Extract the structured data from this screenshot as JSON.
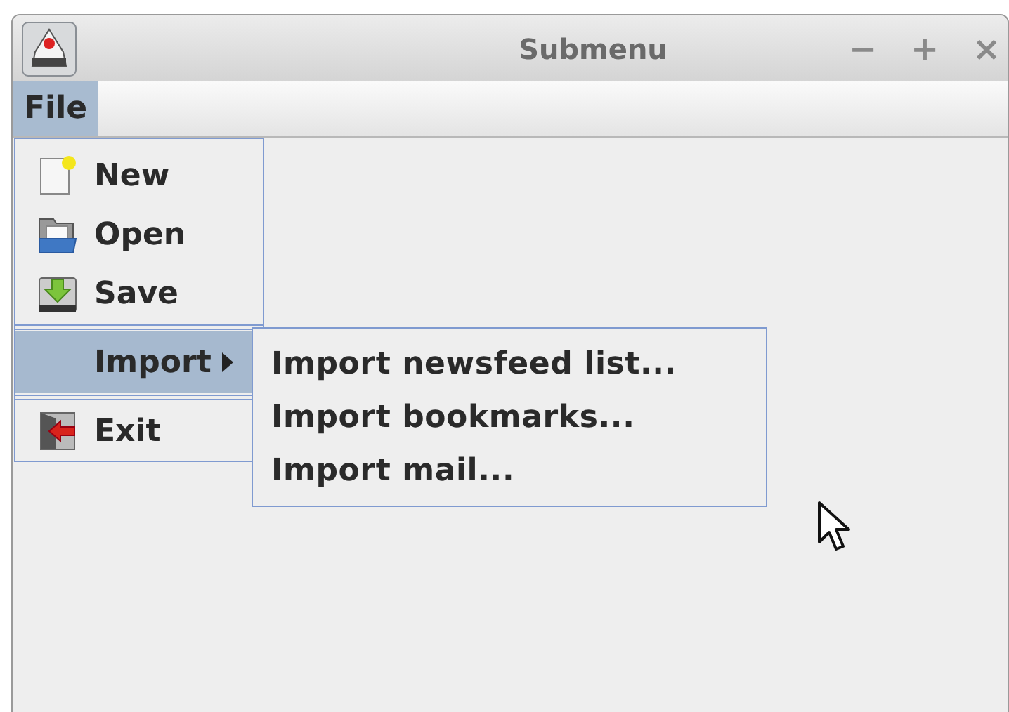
{
  "window": {
    "title": "Submenu",
    "controls": [
      "−",
      "+",
      "×"
    ]
  },
  "menubar": [
    {
      "label": "File",
      "selected": true
    }
  ],
  "file_menu": {
    "groups": [
      [
        {
          "label": "New",
          "kind": "item",
          "selected": false
        },
        {
          "label": "Open",
          "kind": "item",
          "selected": false
        },
        {
          "label": "Save",
          "kind": "item",
          "selected": false
        }
      ],
      [
        {
          "label": "Import",
          "kind": "submenu",
          "selected": true
        }
      ],
      [
        {
          "label": "Exit",
          "kind": "item",
          "selected": false
        }
      ]
    ]
  },
  "submenu": {
    "items": [
      {
        "label": "Import newsfeed list..."
      },
      {
        "label": "Import bookmarks..."
      },
      {
        "label": "Import mail..."
      }
    ]
  }
}
